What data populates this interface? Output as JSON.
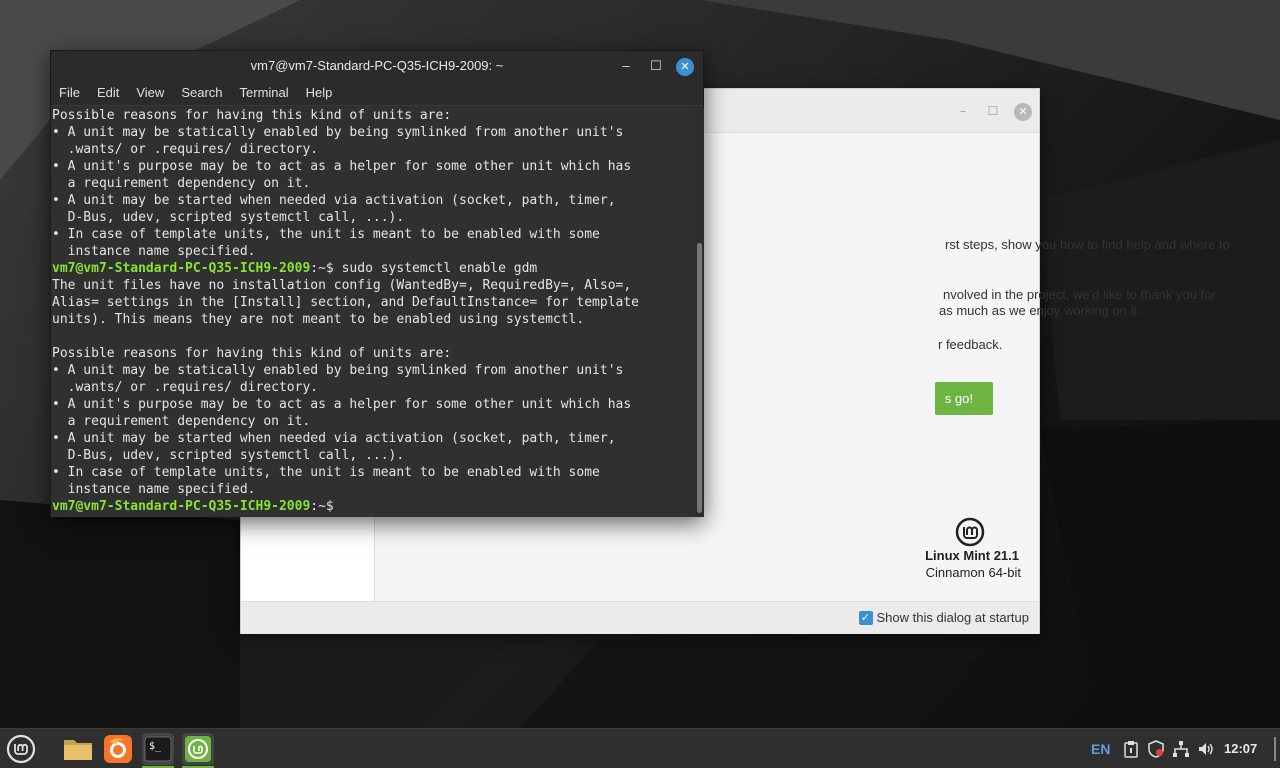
{
  "terminal": {
    "title": "vm7@vm7-Standard-PC-Q35-ICH9-2009: ~",
    "menu": [
      "File",
      "Edit",
      "View",
      "Search",
      "Terminal",
      "Help"
    ],
    "lines": [
      {
        "text": "Possible reasons for having this kind of units are:"
      },
      {
        "text": "• A unit may be statically enabled by being symlinked from another unit's"
      },
      {
        "text": "  .wants/ or .requires/ directory."
      },
      {
        "text": "• A unit's purpose may be to act as a helper for some other unit which has"
      },
      {
        "text": "  a requirement dependency on it."
      },
      {
        "text": "• A unit may be started when needed via activation (socket, path, timer,"
      },
      {
        "text": "  D-Bus, udev, scripted systemctl call, ...)."
      },
      {
        "text": "• In case of template units, the unit is meant to be enabled with some"
      },
      {
        "text": "  instance name specified."
      },
      {
        "prompt": "vm7@vm7-Standard-PC-Q35-ICH9-2009",
        "path": ":~$ ",
        "cmd": "sudo systemctl enable gdm"
      },
      {
        "text": "The unit files have no installation config (WantedBy=, RequiredBy=, Also=,"
      },
      {
        "text": "Alias= settings in the [Install] section, and DefaultInstance= for template"
      },
      {
        "text": "units). This means they are not meant to be enabled using systemctl."
      },
      {
        "text": ""
      },
      {
        "text": "Possible reasons for having this kind of units are:"
      },
      {
        "text": "• A unit may be statically enabled by being symlinked from another unit's"
      },
      {
        "text": "  .wants/ or .requires/ directory."
      },
      {
        "text": "• A unit's purpose may be to act as a helper for some other unit which has"
      },
      {
        "text": "  a requirement dependency on it."
      },
      {
        "text": "• A unit may be started when needed via activation (socket, path, timer,"
      },
      {
        "text": "  D-Bus, udev, scripted systemctl call, ...)."
      },
      {
        "text": "• In case of template units, the unit is meant to be enabled with some"
      },
      {
        "text": "  instance name specified."
      },
      {
        "prompt": "vm7@vm7-Standard-PC-Q35-ICH9-2009",
        "path": ":~$ ",
        "cmd": ""
      }
    ]
  },
  "welcome": {
    "para1": "rst steps, show you how to find help and where to",
    "para2a": "nvolved in the project, we'd like to thank you for",
    "para2b": "as much as we enjoy working on it.",
    "para3": "r feedback.",
    "go_label": "s go!",
    "product_name": "Linux Mint 21.1",
    "edition": "Cinnamon 64-bit",
    "startup_label": "Show this dialog at startup",
    "startup_checked": true
  },
  "taskbar": {
    "language": "EN",
    "clock": "12:07"
  },
  "colors": {
    "mint_green": "#6db442",
    "prompt_green": "#8ae234",
    "accent_blue": "#3d8fd1"
  }
}
